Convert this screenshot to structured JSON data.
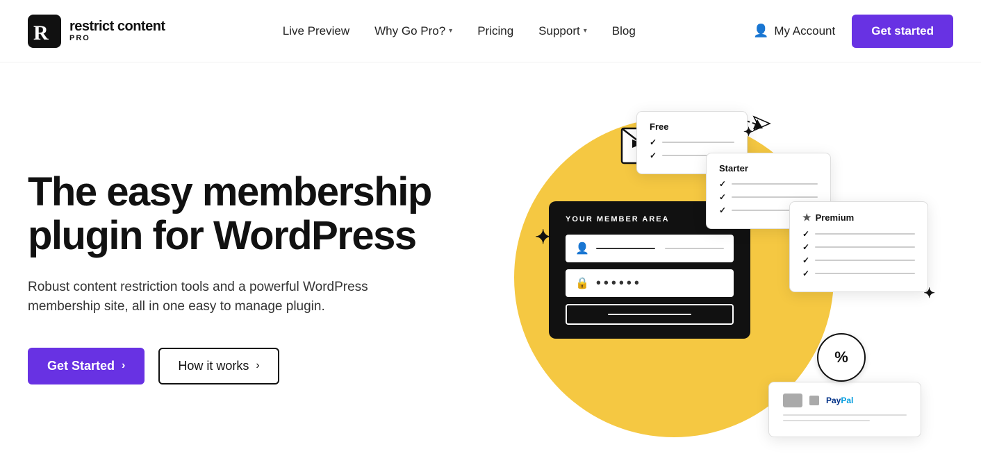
{
  "header": {
    "logo_main": "restrict content",
    "logo_pro": "PRO",
    "nav": [
      {
        "label": "Live Preview",
        "has_dropdown": false
      },
      {
        "label": "Why Go Pro?",
        "has_dropdown": true
      },
      {
        "label": "Pricing",
        "has_dropdown": false
      },
      {
        "label": "Support",
        "has_dropdown": true
      },
      {
        "label": "Blog",
        "has_dropdown": false
      }
    ],
    "my_account_label": "My Account",
    "get_started_label": "Get started"
  },
  "hero": {
    "title": "The easy membership plugin for WordPress",
    "description": "Robust content restriction tools and a powerful WordPress membership site, all in one easy to manage plugin.",
    "cta_primary": "Get Started",
    "cta_secondary": "How it works",
    "member_panel_title": "YOUR MEMBER AREA",
    "pricing_cards": [
      {
        "title": "Free"
      },
      {
        "title": "Starter"
      },
      {
        "title": "Premium"
      }
    ]
  }
}
